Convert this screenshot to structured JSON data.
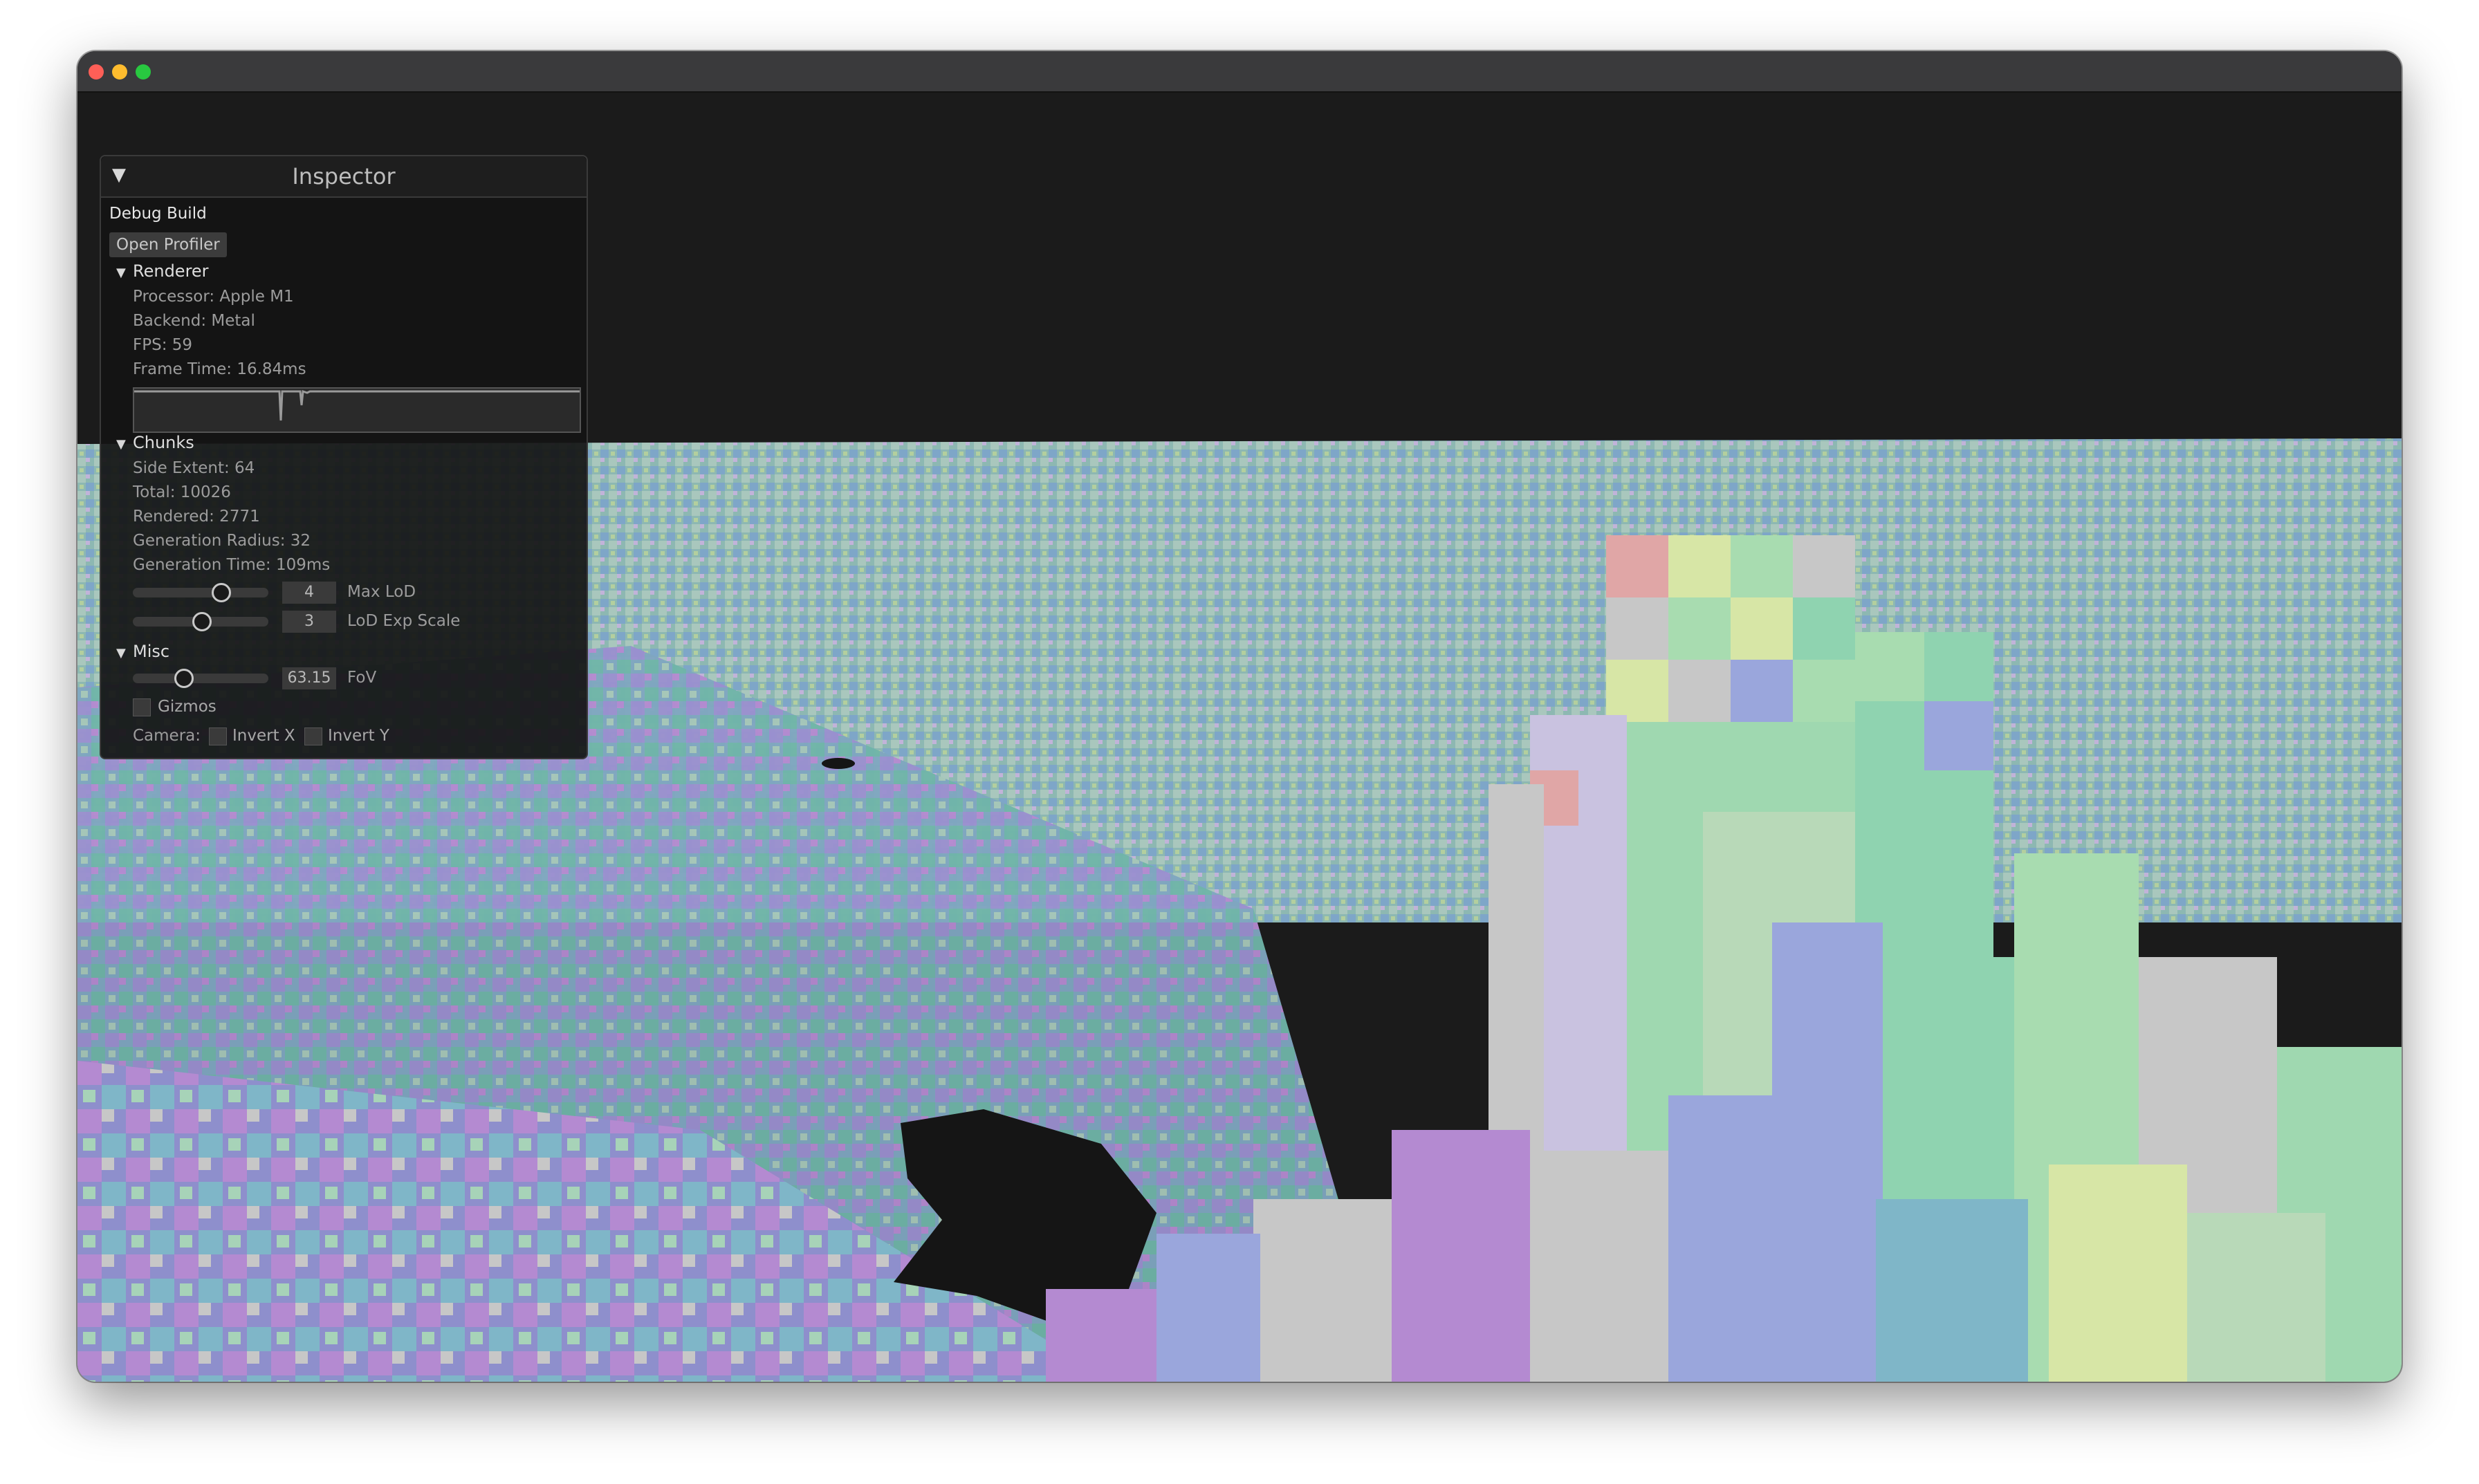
{
  "inspector": {
    "title": "Inspector",
    "collapse_glyph": "▼",
    "build_label": "Debug Build",
    "open_profiler_label": "Open Profiler",
    "renderer": {
      "caret": "▼",
      "label": "Renderer",
      "processor": "Processor: Apple M1",
      "backend": "Backend: Metal",
      "fps": "FPS: 59",
      "frame_time": "Frame Time: 16.84ms"
    },
    "chunks": {
      "caret": "▼",
      "label": "Chunks",
      "side_extent": "Side Extent: 64",
      "total": "Total: 10026",
      "rendered": "Rendered: 2771",
      "generation_radius": "Generation Radius: 32",
      "generation_time": "Generation Time: 109ms",
      "max_lod": {
        "value": "4",
        "label": "Max LoD"
      },
      "lod_exp_scale": {
        "value": "3",
        "label": "LoD Exp Scale"
      }
    },
    "misc": {
      "caret": "▼",
      "label": "Misc",
      "fov": {
        "value": "63.15",
        "label": "FoV"
      },
      "gizmos_label": "Gizmos",
      "camera_label": "Camera:",
      "invert_x_label": "Invert X",
      "invert_y_label": "Invert Y"
    }
  },
  "colors": {
    "window_chrome": "#3a3a3c",
    "sky": "#1b1b1b",
    "panel_bg": "#141414",
    "voxel_palette": [
      "#8fd3b0",
      "#9aa6dc",
      "#b48ad1",
      "#c7c7c7",
      "#d7e6a6",
      "#e0a6a6",
      "#6fb0c4"
    ]
  },
  "icons": [
    "close-traffic-light",
    "minimize-traffic-light",
    "zoom-traffic-light",
    "collapse-triangle-icon",
    "section-caret-icon"
  ]
}
